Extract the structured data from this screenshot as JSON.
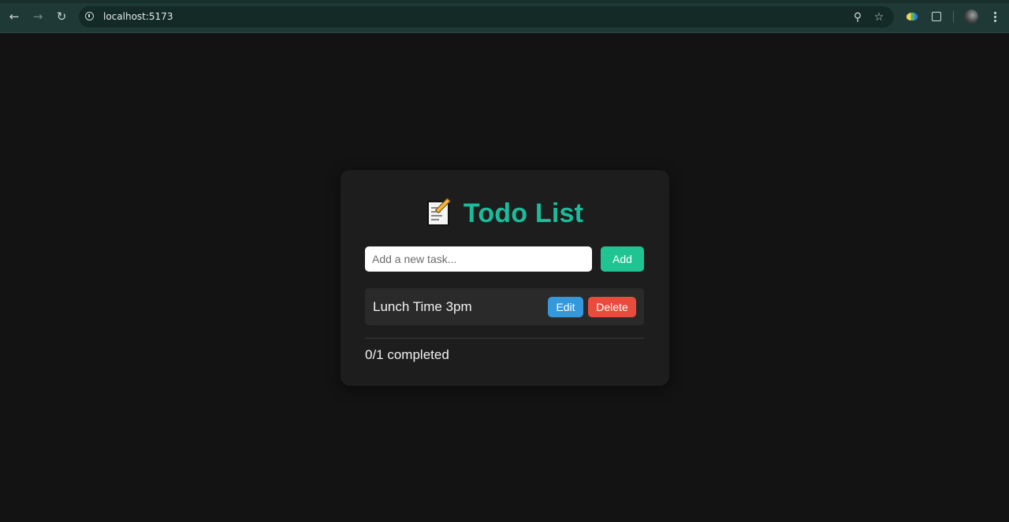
{
  "browser": {
    "url": "localhost:5173",
    "icons": {
      "back": "back-arrow-icon",
      "forward": "forward-arrow-icon",
      "reload": "reload-icon",
      "site_info": "info-icon",
      "zoom": "zoom-icon",
      "bookmark": "star-icon",
      "extension": "extension-icon",
      "extensions_menu": "puzzle-icon",
      "profile": "avatar",
      "menu": "kebab-menu-icon"
    }
  },
  "app": {
    "emoji": "memo-icon",
    "title": "Todo List",
    "input_placeholder": "Add a new task...",
    "input_value": "",
    "add_label": "Add",
    "todos": [
      {
        "text": "Lunch Time 3pm",
        "edit_label": "Edit",
        "delete_label": "Delete",
        "completed": false
      }
    ],
    "status": "0/1 completed"
  },
  "colors": {
    "page_background": "#131313",
    "card_background": "#1d1d1d",
    "title": "#1bbc9b",
    "add_button": "#1fc492",
    "edit_button": "#3498db",
    "delete_button": "#e74c3c",
    "todo_item_background": "#2a2a2a",
    "browser_chrome": "#1f3a36"
  }
}
